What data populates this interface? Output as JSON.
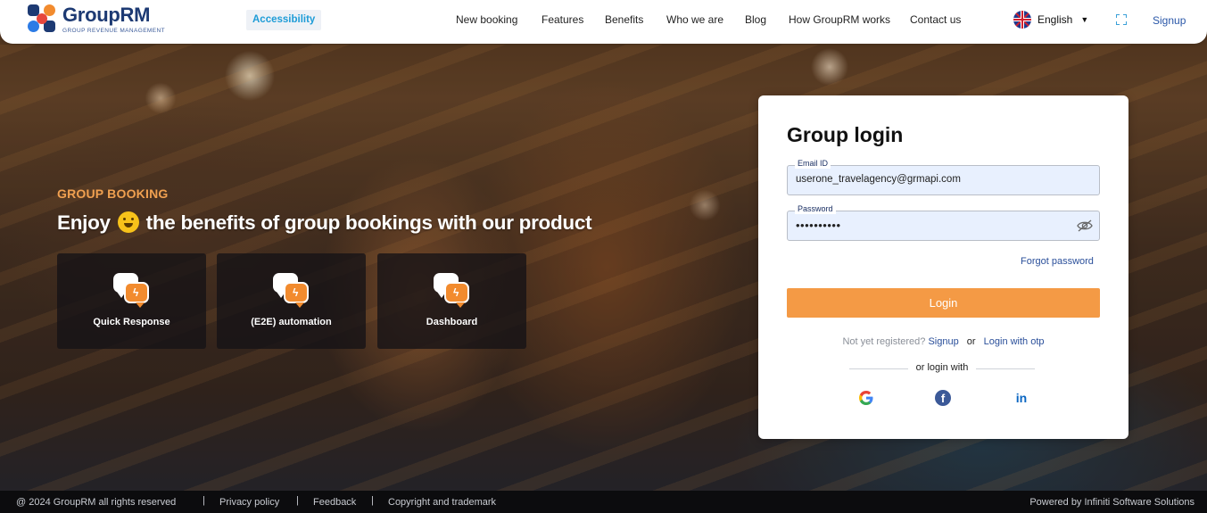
{
  "header": {
    "brand_name": "GroupRM",
    "brand_tagline": "GROUP REVENUE MANAGEMENT",
    "accessibility_label": "Accessibility",
    "nav": [
      "New booking",
      "Features",
      "Benefits",
      "Who we are",
      "Blog",
      "How GroupRM works",
      "Contact us"
    ],
    "language": "English",
    "signup_label": "Signup",
    "icons": [
      "grouprm-logo",
      "uk-flag-icon",
      "caret-down-icon",
      "fullscreen-icon"
    ]
  },
  "hero": {
    "kicker": "GROUP BOOKING",
    "headline_before": "Enjoy",
    "headline_after": "the benefits of group bookings with our product",
    "emoji": "hugging-face-icon",
    "cards": [
      {
        "label": "Quick Response",
        "icon": "chat-bolt-icon"
      },
      {
        "label": "(E2E) automation",
        "icon": "chat-bolt-icon"
      },
      {
        "label": "Dashboard",
        "icon": "chat-bolt-icon"
      }
    ]
  },
  "login": {
    "title": "Group login",
    "email_label": "Email ID",
    "email_value": "userone_travelagency@grmapi.com",
    "password_label": "Password",
    "password_value": "••••••••••",
    "forgot_label": "Forgot password",
    "login_button": "Login",
    "not_registered": "Not yet registered?",
    "signup_link": "Signup",
    "or": "or",
    "otp_link": "Login with otp",
    "or_login_with": "or login with",
    "social": [
      "google-icon",
      "facebook-icon",
      "linkedin-icon"
    ]
  },
  "footer": {
    "copyright": "@ 2024  GroupRM  all rights reserved",
    "privacy": "Privacy policy",
    "feedback": "Feedback",
    "trademark": "Copyright and trademark",
    "powered": "Powered by Infiniti Software Solutions"
  },
  "colors": {
    "accent_orange": "#f49a45",
    "brand_navy": "#1d3a73",
    "link_blue": "#2a4f9a",
    "accessibility_blue": "#1e9cd7"
  }
}
